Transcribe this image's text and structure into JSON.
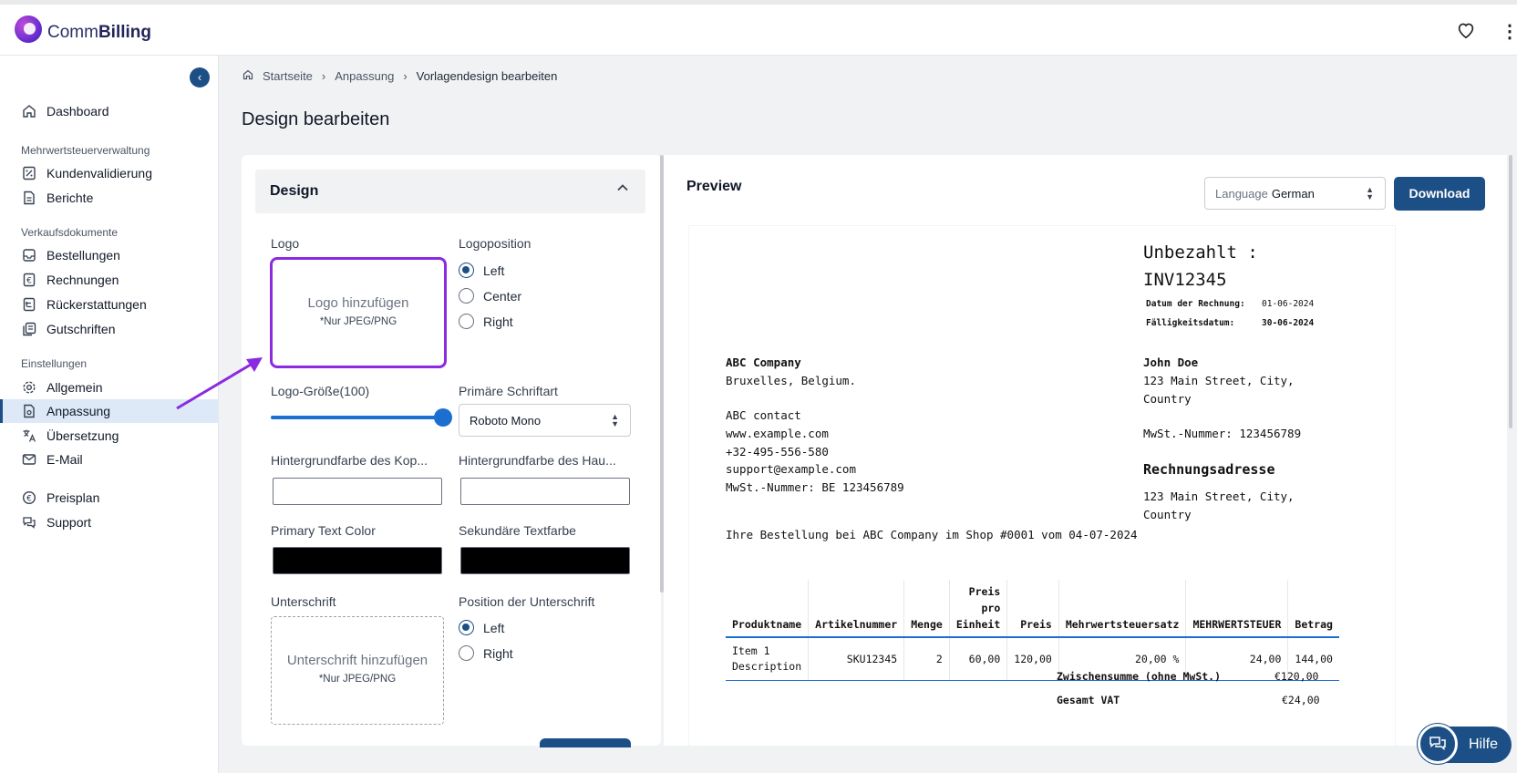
{
  "app": {
    "brand_light": "Comm",
    "brand_bold": "Billing"
  },
  "header": {
    "favorite_icon": "heart-icon",
    "menu_icon": "kebab-icon"
  },
  "sidebar": {
    "dashboard": "Dashboard",
    "section_vat": "Mehrwertsteuerverwaltung",
    "kundenvalidierung": "Kundenvalidierung",
    "berichte": "Berichte",
    "section_sales": "Verkaufsdokumente",
    "bestellungen": "Bestellungen",
    "rechnungen": "Rechnungen",
    "rueckerstattungen": "Rückerstattungen",
    "gutschriften": "Gutschriften",
    "section_settings": "Einstellungen",
    "allgemein": "Allgemein",
    "anpassung": "Anpassung",
    "uebersetzung": "Übersetzung",
    "email": "E-Mail",
    "preisplan": "Preisplan",
    "support": "Support"
  },
  "breadcrumb": {
    "home": "Startseite",
    "parent": "Anpassung",
    "current": "Vorlagendesign bearbeiten"
  },
  "page": {
    "title": "Design bearbeiten"
  },
  "design": {
    "section_title": "Design",
    "logo_label": "Logo",
    "logo_add": "Logo hinzufügen",
    "logo_hint": "*Nur JPEG/PNG",
    "logo_position_label": "Logoposition",
    "logo_position_options": [
      "Left",
      "Center",
      "Right"
    ],
    "logo_position_selected": "Left",
    "logo_size_label": "Logo-Größe(100)",
    "logo_size_value": 100,
    "font_label": "Primäre Schriftart",
    "font_value": "Roboto Mono",
    "header_bg_label": "Hintergrundfarbe des Kop...",
    "main_bg_label": "Hintergrundfarbe des Hau...",
    "header_bg_color": "#ffffff",
    "main_bg_color": "#ffffff",
    "primary_text_label": "Primary Text Color",
    "secondary_text_label": "Sekundäre Textfarbe",
    "primary_text_color": "#000000",
    "secondary_text_color": "#000000",
    "signature_label": "Unterschrift",
    "signature_add": "Unterschrift hinzufügen",
    "signature_hint": "*Nur JPEG/PNG",
    "signature_position_label": "Position der Unterschrift",
    "signature_position_options": [
      "Left",
      "Right"
    ],
    "signature_position_selected": "Left"
  },
  "preview": {
    "title": "Preview",
    "language_label": "Language",
    "language_value": "German",
    "download_label": "Download"
  },
  "invoice": {
    "status_line": "Unbezahlt :",
    "number": "INV12345",
    "date_label": "Datum der Rechnung:",
    "date_value": "01-06-2024",
    "due_label": "Fälligkeitsdatum:",
    "due_value": "30-06-2024",
    "seller_name": "ABC Company",
    "seller_city": "Bruxelles, Belgium.",
    "seller_contact": "ABC contact",
    "seller_web": "www.example.com",
    "seller_phone": "+32-495-556-580",
    "seller_email": "support@example.com",
    "seller_vat": "MwSt.-Nummer: BE 123456789",
    "buyer_name": "John Doe",
    "buyer_addr1": "123 Main Street, City,",
    "buyer_addr2": "Country",
    "buyer_vat": "MwSt.-Nummer: 123456789",
    "billing_title": "Rechnungsadresse",
    "billing_addr1": "123 Main Street, City,",
    "billing_addr2": "Country",
    "order_line": "Ihre Bestellung bei ABC Company im Shop #0001 vom 04-07-2024",
    "columns": [
      "Produktname",
      "Artikelnummer",
      "Menge",
      "Preis pro Einheit",
      "Preis",
      "Mehrwertsteuersatz",
      "MEHRWERTSTEUER",
      "Betrag"
    ],
    "col_unit_price_lines": [
      "Preis",
      "pro",
      "Einheit"
    ],
    "row": {
      "name_l1": "Item 1",
      "name_l2": "Description",
      "sku": "SKU12345",
      "qty": "2",
      "unit": "60,00",
      "price": "120,00",
      "rate": "20,00 %",
      "vat": "24,00",
      "amount": "144,00"
    },
    "subtotal_label": "Zwischensumme (ohne MwSt.)",
    "subtotal_value": "€120,00",
    "total_vat_label": "Gesamt VAT",
    "total_vat_value": "€24,00"
  },
  "help": {
    "label": "Hilfe"
  },
  "colors": {
    "primary": "#1c4f86",
    "active_bg": "#dde9f7",
    "annotation": "#8a2be2"
  }
}
